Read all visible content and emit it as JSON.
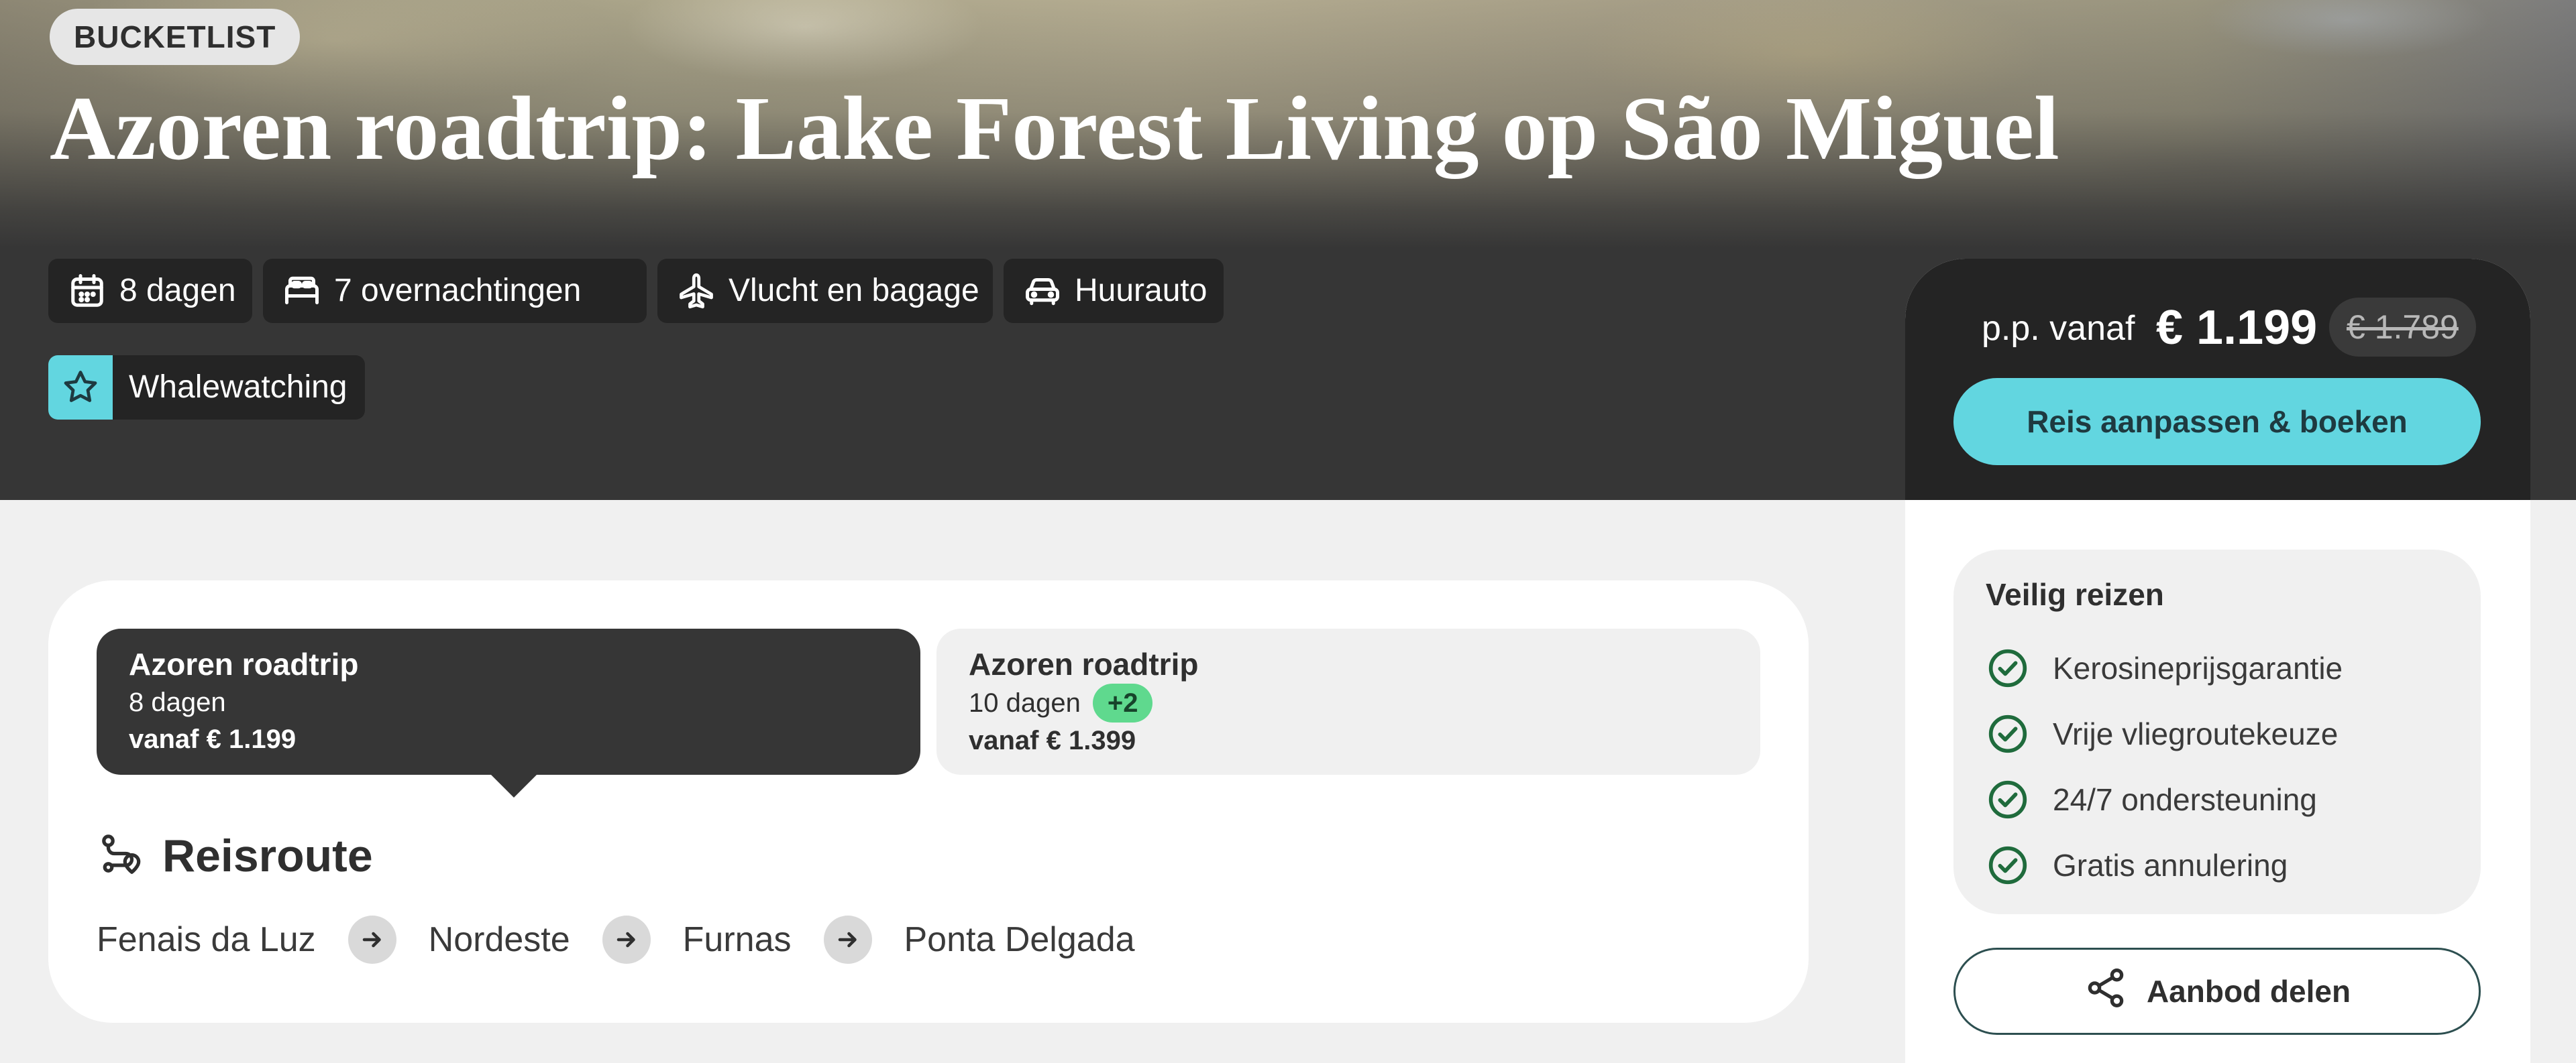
{
  "hero": {
    "badge": "BUCKETLIST",
    "title": "Azoren roadtrip: Lake Forest Living op São Miguel",
    "features": [
      {
        "icon": "calendar-icon",
        "label": "8 dagen"
      },
      {
        "icon": "bed-icon",
        "label": "7 overnachtingen"
      },
      {
        "icon": "plane-icon",
        "label": "Vlucht en bagage"
      },
      {
        "icon": "car-icon",
        "label": "Huurauto"
      },
      {
        "icon": "star-icon",
        "label": "Whalewatching"
      }
    ]
  },
  "booking": {
    "price_prefix": "p.p. vanaf",
    "price": "€ 1.199",
    "old_price": "€ 1.789",
    "cta_label": "Reis aanpassen & boeken",
    "safe_travel": {
      "title": "Veilig reizen",
      "items": [
        "Kerosineprijsgarantie",
        "Vrije vliegroutekeuze",
        "24/7 ondersteuning",
        "Gratis annulering"
      ]
    },
    "share_label": "Aanbod delen"
  },
  "options": [
    {
      "title": "Azoren roadtrip",
      "duration": "8 dagen",
      "price": "vanaf € 1.199",
      "selected": true
    },
    {
      "title": "Azoren roadtrip",
      "duration": "10 dagen",
      "extra_badge": "+2",
      "price": "vanaf € 1.399",
      "selected": false
    }
  ],
  "route": {
    "heading": "Reisroute",
    "stops": [
      "Fenais da Luz",
      "Nordeste",
      "Furnas",
      "Ponta Delgada"
    ]
  },
  "colors": {
    "accent": "#62d6e0",
    "dark": "#363636",
    "badge_green": "#5fd98e",
    "check_green": "#1f6b3c"
  }
}
